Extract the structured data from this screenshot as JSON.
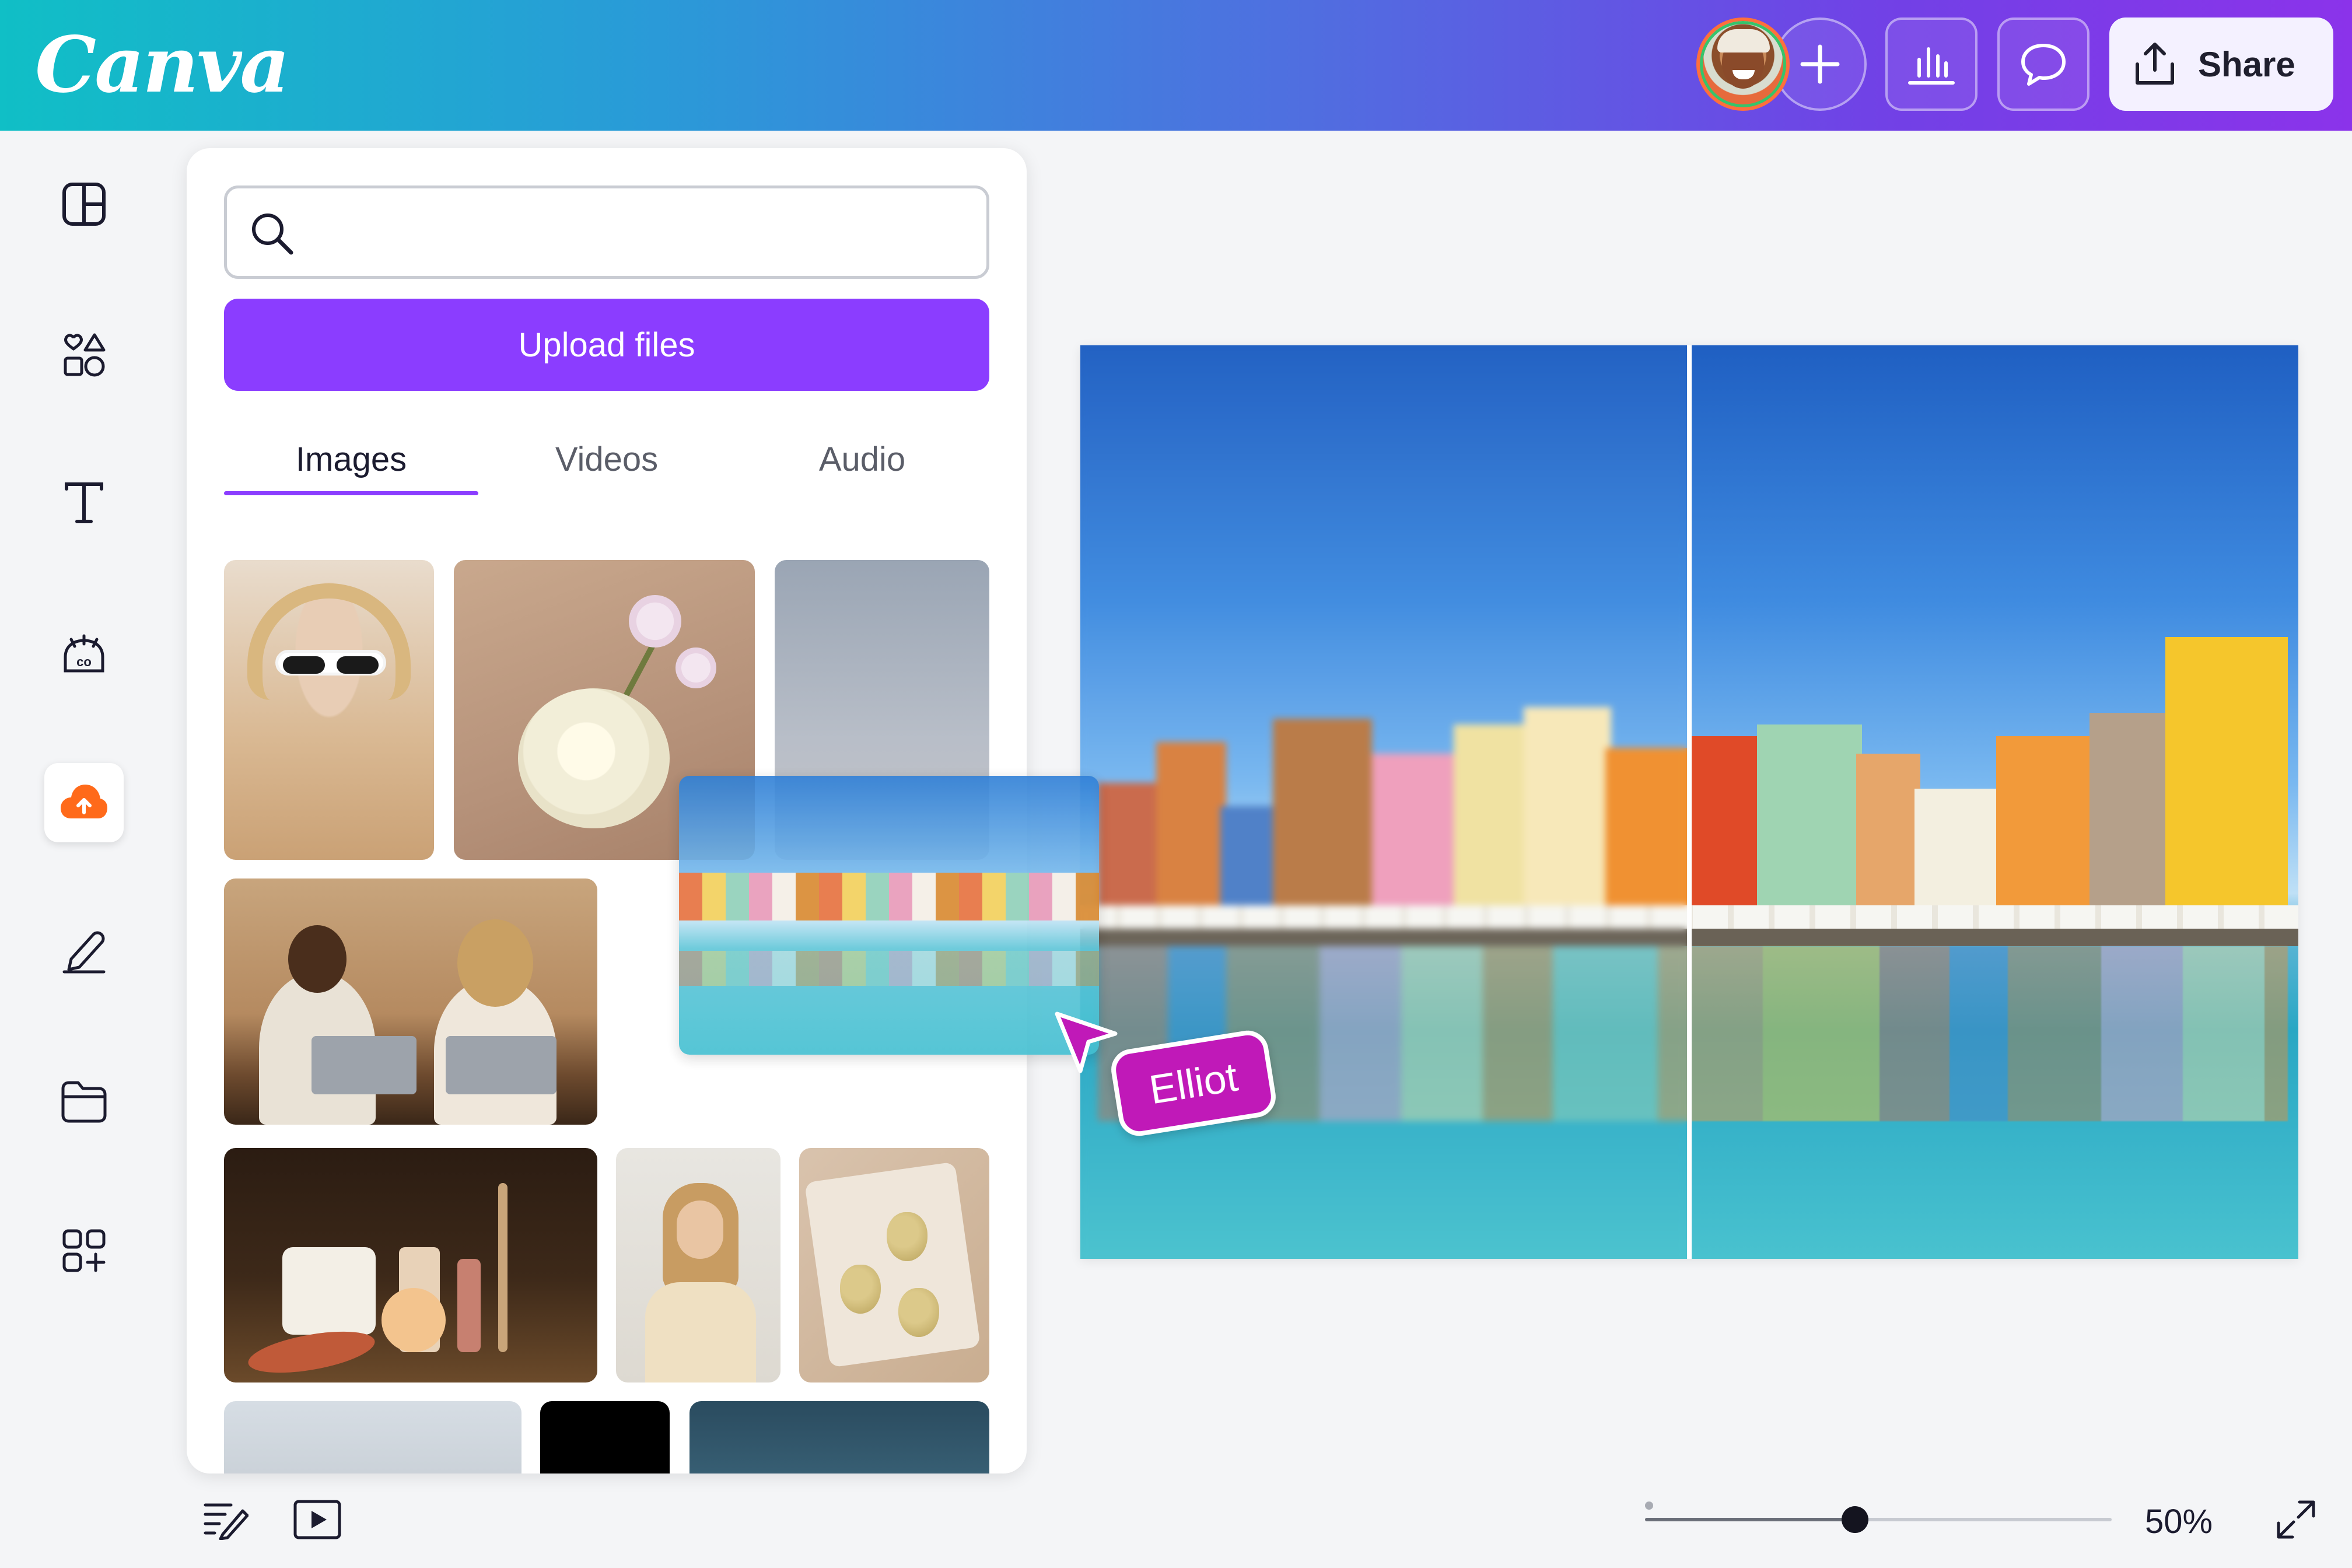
{
  "app": {
    "logo_text": "Canva",
    "brand_color": "#8b3dff"
  },
  "header": {
    "avatar_icon": "user-avatar",
    "add_icon": "plus-icon",
    "insights_icon": "bar-chart-icon",
    "comment_icon": "comment-icon",
    "share": {
      "label": "Share",
      "icon": "share-upload-icon"
    }
  },
  "rail": {
    "items": [
      {
        "icon": "design-layout-icon"
      },
      {
        "icon": "elements-shapes-icon"
      },
      {
        "icon": "text-icon"
      },
      {
        "icon": "brand-icon"
      },
      {
        "icon": "uploads-cloud-icon",
        "active": true,
        "accent": "#ff6a1a"
      },
      {
        "icon": "draw-pen-icon"
      },
      {
        "icon": "projects-folder-icon"
      },
      {
        "icon": "apps-grid-icon"
      }
    ]
  },
  "panel": {
    "search": {
      "value": "",
      "placeholder": ""
    },
    "upload_button": "Upload files",
    "tabs": [
      {
        "label": "Images",
        "active": true
      },
      {
        "label": "Videos",
        "active": false
      },
      {
        "label": "Audio",
        "active": false
      }
    ]
  },
  "collaborator": {
    "name": "Elliot",
    "color": "#c019b8"
  },
  "bottom_bar": {
    "notes_icon": "notes-icon",
    "present_icon": "play-present-icon",
    "zoom": {
      "value": 0.5,
      "label": "50%"
    },
    "fullscreen_icon": "expand-icon"
  }
}
